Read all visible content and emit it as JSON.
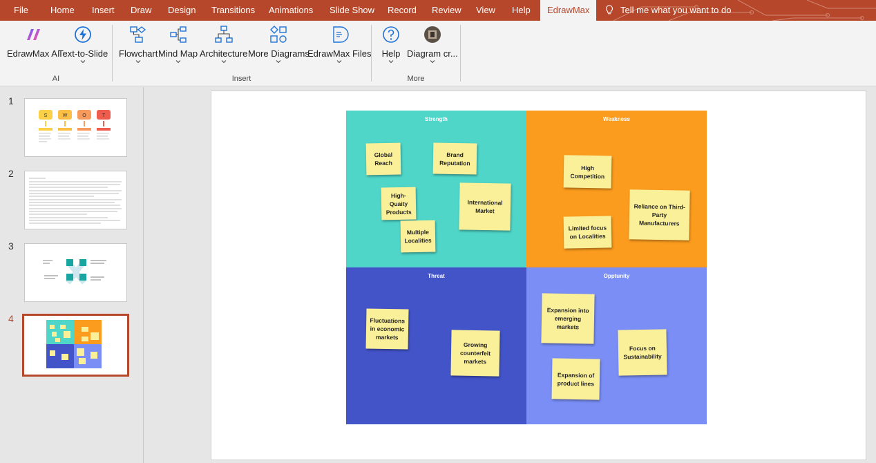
{
  "tabs": [
    {
      "label": "File"
    },
    {
      "label": "Home"
    },
    {
      "label": "Insert"
    },
    {
      "label": "Draw"
    },
    {
      "label": "Design"
    },
    {
      "label": "Transitions"
    },
    {
      "label": "Animations"
    },
    {
      "label": "Slide Show"
    },
    {
      "label": "Record"
    },
    {
      "label": "Review"
    },
    {
      "label": "View"
    },
    {
      "label": "Help"
    },
    {
      "label": "EdrawMax"
    }
  ],
  "tell_me": "Tell me what you want to do",
  "ribbon": {
    "groups": [
      {
        "label": "AI",
        "buttons": [
          {
            "label": "EdrawMax AI"
          },
          {
            "label": "Text-to-Slide"
          }
        ]
      },
      {
        "label": "Insert",
        "buttons": [
          {
            "label": "Flowchart"
          },
          {
            "label": "Mind Map"
          },
          {
            "label": "Architecture"
          },
          {
            "label": "More Diagrams"
          },
          {
            "label": "EdrawMax Files"
          }
        ]
      },
      {
        "label": "More",
        "buttons": [
          {
            "label": "Help"
          },
          {
            "label": "Diagram cr..."
          }
        ]
      }
    ]
  },
  "slides": [
    {
      "number": "1"
    },
    {
      "number": "2"
    },
    {
      "number": "3"
    },
    {
      "number": "4"
    }
  ],
  "thumb1": {
    "letters": [
      "S",
      "W",
      "O",
      "T"
    ]
  },
  "swot": {
    "strength": {
      "title": "Strength",
      "notes": [
        "Global Reach",
        "Brand Reputation",
        "High-Quaity Products",
        "International Market",
        "Multiple Localities"
      ]
    },
    "weakness": {
      "title": "Weakness",
      "notes": [
        "High Competition",
        "Reliance on Third-Party Manufacturers",
        "Limited focus on Localities"
      ]
    },
    "threat": {
      "title": "Threat",
      "notes": [
        "Fluctuations in economic markets",
        "Growing counterfeit markets"
      ]
    },
    "opportunity": {
      "title": "Opptunity",
      "notes": [
        "Expansion into emerging markets",
        "Focus on Sustainability",
        "Expansion of product lines"
      ]
    }
  },
  "colors": {
    "accent": "#b7472a",
    "strength": "#4fd6c8",
    "weakness": "#fc9c1e",
    "threat": "#4354c9",
    "opportunity": "#7a8ef6",
    "note": "#fbf09a"
  }
}
